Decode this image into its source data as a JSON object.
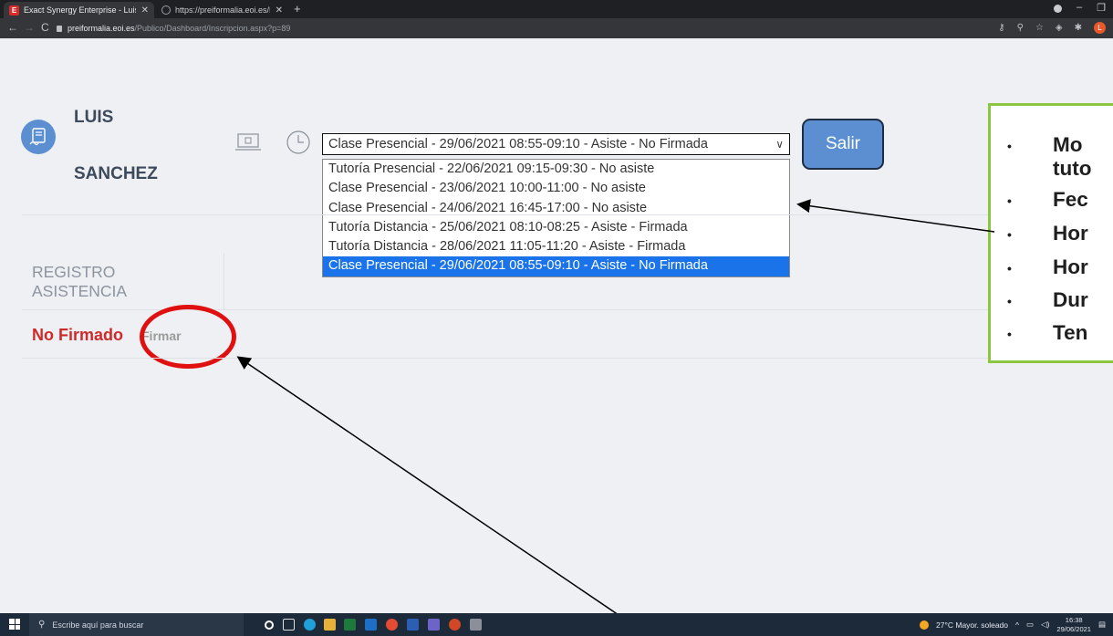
{
  "browser": {
    "tabs": [
      {
        "title": "Exact Synergy Enterprise - Luis Sa",
        "active": true
      },
      {
        "title": "https://preiformalia.eoi.es/Public",
        "active": false
      }
    ],
    "new_tab_label": "+",
    "url_domain": "preiformalia.eoi.es",
    "url_path": "/Publico/Dashboard/Inscripcion.aspx?p=89",
    "profile_initial": "L"
  },
  "user": {
    "first_name": "LUIS",
    "last_name": "SANCHEZ"
  },
  "session_select": {
    "selected_value": "Clase Presencial - 29/06/2021 08:55-09:10 - Asiste - No Firmada",
    "options": [
      "Tutoría Presencial - 22/06/2021 09:15-09:30 - No asiste",
      "Clase Presencial - 23/06/2021 10:00-11:00 - No asiste",
      "Clase Presencial - 24/06/2021 16:45-17:00 - No asiste",
      "Tutoría Distancia - 25/06/2021 08:10-08:25 - Asiste - Firmada",
      "Tutoría Distancia - 28/06/2021 11:05-11:20 - Asiste - Firmada",
      "Clase Presencial - 29/06/2021 08:55-09:10 - Asiste - No Firmada"
    ]
  },
  "exit_button_label": "Salir",
  "attendance": {
    "section_title_line1": "REGISTRO",
    "section_title_line2": "ASISTENCIA",
    "status": "No Firmado",
    "sign_link": "Firmar"
  },
  "callout": {
    "items": [
      "Mo",
      "tuto",
      "Fec",
      "Hor",
      "Hor",
      "Dur",
      "Ten"
    ]
  },
  "taskbar": {
    "search_placeholder": "Escribe aquí para buscar",
    "weather": "27°C  Mayor. soleado",
    "time": "16:38",
    "date": "29/06/2021"
  },
  "colors": {
    "accent_blue": "#5b8fd1",
    "status_red": "#cf2a2a",
    "callout_border": "#8cc63f",
    "highlight_circle": "#e01010",
    "selected_option": "#1a73e8"
  }
}
